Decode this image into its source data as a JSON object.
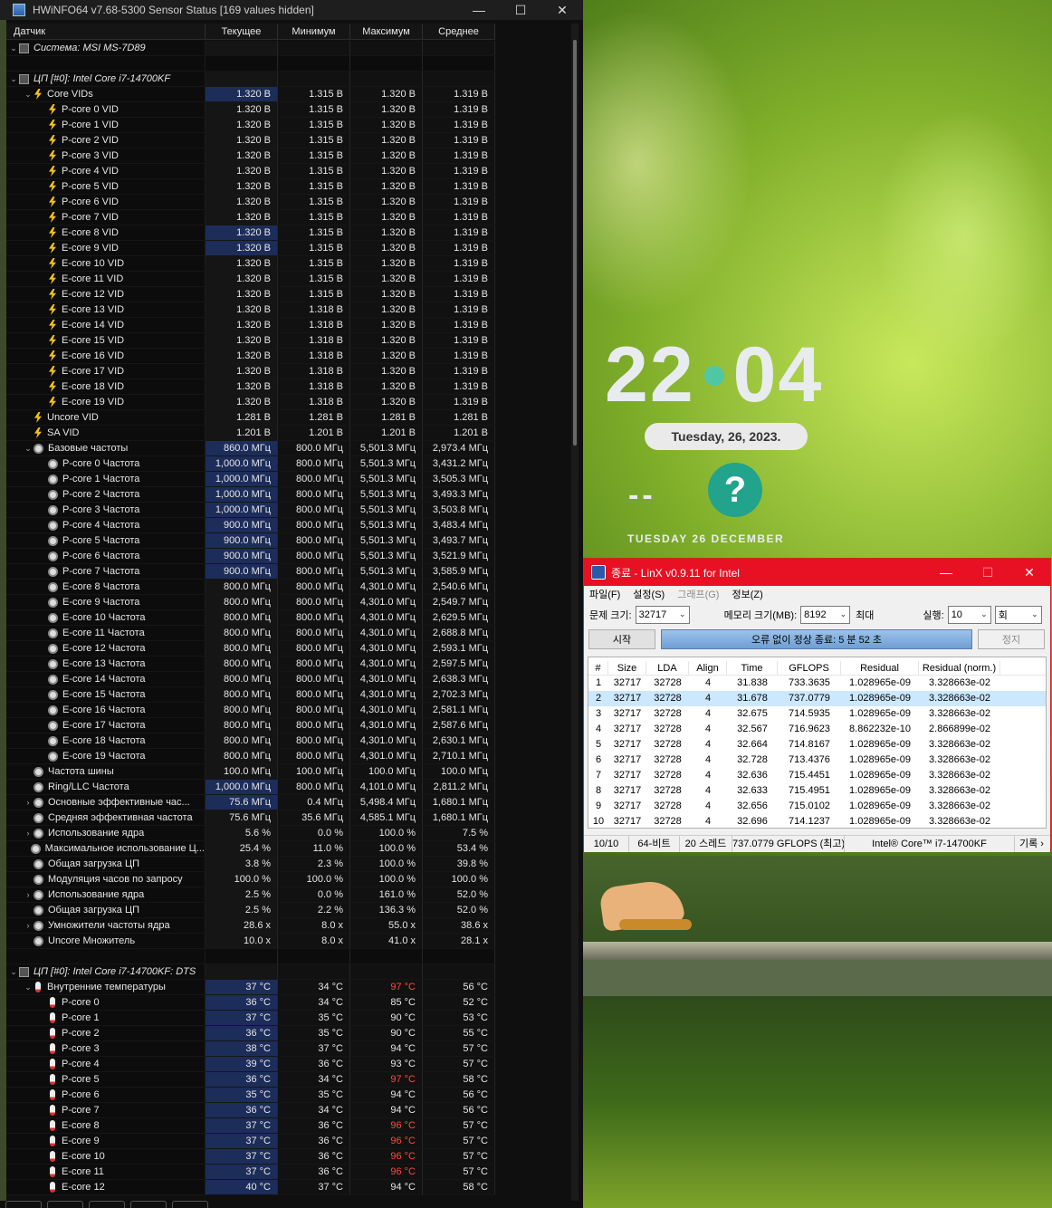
{
  "hwinfo": {
    "title": "HWiNFO64 v7.68-5300 Sensor Status [169 values hidden]",
    "window_buttons": [
      "—",
      "☐",
      "✕"
    ],
    "columns": [
      "Датчик",
      "Текущее",
      "Минимум",
      "Максимум",
      "Среднее"
    ],
    "rows": [
      {
        "t": "grp",
        "lvl": 0,
        "chev": "⌄",
        "icon": "chip",
        "label": "Система: MSI MS-7D89"
      },
      {
        "t": "sep"
      },
      {
        "t": "grp",
        "lvl": 0,
        "chev": "⌄",
        "icon": "chip",
        "label": "ЦП [#0]: Intel Core i7-14700KF"
      },
      {
        "lvl": 1,
        "chev": "⌄",
        "icon": "volt",
        "label": "Core VIDs",
        "v": [
          "1.320 В",
          "1.315 В",
          "1.320 В",
          "1.319 В"
        ],
        "hl": true
      },
      {
        "lvl": 2,
        "icon": "volt",
        "label": "P-core 0 VID",
        "v": [
          "1.320 В",
          "1.315 В",
          "1.320 В",
          "1.319 В"
        ]
      },
      {
        "lvl": 2,
        "icon": "volt",
        "label": "P-core 1 VID",
        "v": [
          "1.320 В",
          "1.315 В",
          "1.320 В",
          "1.319 В"
        ]
      },
      {
        "lvl": 2,
        "icon": "volt",
        "label": "P-core 2 VID",
        "v": [
          "1.320 В",
          "1.315 В",
          "1.320 В",
          "1.319 В"
        ]
      },
      {
        "lvl": 2,
        "icon": "volt",
        "label": "P-core 3 VID",
        "v": [
          "1.320 В",
          "1.315 В",
          "1.320 В",
          "1.319 В"
        ]
      },
      {
        "lvl": 2,
        "icon": "volt",
        "label": "P-core 4 VID",
        "v": [
          "1.320 В",
          "1.315 В",
          "1.320 В",
          "1.319 В"
        ]
      },
      {
        "lvl": 2,
        "icon": "volt",
        "label": "P-core 5 VID",
        "v": [
          "1.320 В",
          "1.315 В",
          "1.320 В",
          "1.319 В"
        ]
      },
      {
        "lvl": 2,
        "icon": "volt",
        "label": "P-core 6 VID",
        "v": [
          "1.320 В",
          "1.315 В",
          "1.320 В",
          "1.319 В"
        ]
      },
      {
        "lvl": 2,
        "icon": "volt",
        "label": "P-core 7 VID",
        "v": [
          "1.320 В",
          "1.315 В",
          "1.320 В",
          "1.319 В"
        ]
      },
      {
        "lvl": 2,
        "icon": "volt",
        "label": "E-core 8 VID",
        "v": [
          "1.320 В",
          "1.315 В",
          "1.320 В",
          "1.319 В"
        ],
        "hl": true
      },
      {
        "lvl": 2,
        "icon": "volt",
        "label": "E-core 9 VID",
        "v": [
          "1.320 В",
          "1.315 В",
          "1.320 В",
          "1.319 В"
        ],
        "hl": true
      },
      {
        "lvl": 2,
        "icon": "volt",
        "label": "E-core 10 VID",
        "v": [
          "1.320 В",
          "1.315 В",
          "1.320 В",
          "1.319 В"
        ]
      },
      {
        "lvl": 2,
        "icon": "volt",
        "label": "E-core 11 VID",
        "v": [
          "1.320 В",
          "1.315 В",
          "1.320 В",
          "1.319 В"
        ]
      },
      {
        "lvl": 2,
        "icon": "volt",
        "label": "E-core 12 VID",
        "v": [
          "1.320 В",
          "1.315 В",
          "1.320 В",
          "1.319 В"
        ]
      },
      {
        "lvl": 2,
        "icon": "volt",
        "label": "E-core 13 VID",
        "v": [
          "1.320 В",
          "1.318 В",
          "1.320 В",
          "1.319 В"
        ]
      },
      {
        "lvl": 2,
        "icon": "volt",
        "label": "E-core 14 VID",
        "v": [
          "1.320 В",
          "1.318 В",
          "1.320 В",
          "1.319 В"
        ]
      },
      {
        "lvl": 2,
        "icon": "volt",
        "label": "E-core 15 VID",
        "v": [
          "1.320 В",
          "1.318 В",
          "1.320 В",
          "1.319 В"
        ]
      },
      {
        "lvl": 2,
        "icon": "volt",
        "label": "E-core 16 VID",
        "v": [
          "1.320 В",
          "1.318 В",
          "1.320 В",
          "1.319 В"
        ]
      },
      {
        "lvl": 2,
        "icon": "volt",
        "label": "E-core 17 VID",
        "v": [
          "1.320 В",
          "1.318 В",
          "1.320 В",
          "1.319 В"
        ]
      },
      {
        "lvl": 2,
        "icon": "volt",
        "label": "E-core 18 VID",
        "v": [
          "1.320 В",
          "1.318 В",
          "1.320 В",
          "1.319 В"
        ]
      },
      {
        "lvl": 2,
        "icon": "volt",
        "label": "E-core 19 VID",
        "v": [
          "1.320 В",
          "1.318 В",
          "1.320 В",
          "1.319 В"
        ]
      },
      {
        "lvl": 1,
        "icon": "volt",
        "label": "Uncore VID",
        "v": [
          "1.281 В",
          "1.281 В",
          "1.281 В",
          "1.281 В"
        ]
      },
      {
        "lvl": 1,
        "icon": "volt",
        "label": "SA VID",
        "v": [
          "1.201 В",
          "1.201 В",
          "1.201 В",
          "1.201 В"
        ]
      },
      {
        "lvl": 1,
        "chev": "⌄",
        "icon": "clock",
        "label": "Базовые частоты",
        "v": [
          "860.0 МГц",
          "800.0 МГц",
          "5,501.3 МГц",
          "2,973.4 МГц"
        ],
        "hl": true
      },
      {
        "lvl": 2,
        "icon": "clock",
        "label": "P-core 0 Частота",
        "v": [
          "1,000.0 МГц",
          "800.0 МГц",
          "5,501.3 МГц",
          "3,431.2 МГц"
        ],
        "hl": true
      },
      {
        "lvl": 2,
        "icon": "clock",
        "label": "P-core 1 Частота",
        "v": [
          "1,000.0 МГц",
          "800.0 МГц",
          "5,501.3 МГц",
          "3,505.3 МГц"
        ],
        "hl": true
      },
      {
        "lvl": 2,
        "icon": "clock",
        "label": "P-core 2 Частота",
        "v": [
          "1,000.0 МГц",
          "800.0 МГц",
          "5,501.3 МГц",
          "3,493.3 МГц"
        ],
        "hl": true
      },
      {
        "lvl": 2,
        "icon": "clock",
        "label": "P-core 3 Частота",
        "v": [
          "1,000.0 МГц",
          "800.0 МГц",
          "5,501.3 МГц",
          "3,503.8 МГц"
        ],
        "hl": true
      },
      {
        "lvl": 2,
        "icon": "clock",
        "label": "P-core 4 Частота",
        "v": [
          "900.0 МГц",
          "800.0 МГц",
          "5,501.3 МГц",
          "3,483.4 МГц"
        ],
        "hl": true
      },
      {
        "lvl": 2,
        "icon": "clock",
        "label": "P-core 5 Частота",
        "v": [
          "900.0 МГц",
          "800.0 МГц",
          "5,501.3 МГц",
          "3,493.7 МГц"
        ],
        "hl": true
      },
      {
        "lvl": 2,
        "icon": "clock",
        "label": "P-core 6 Частота",
        "v": [
          "900.0 МГц",
          "800.0 МГц",
          "5,501.3 МГц",
          "3,521.9 МГц"
        ],
        "hl": true
      },
      {
        "lvl": 2,
        "icon": "clock",
        "label": "P-core 7 Частота",
        "v": [
          "900.0 МГц",
          "800.0 МГц",
          "5,501.3 МГц",
          "3,585.9 МГц"
        ],
        "hl": true
      },
      {
        "lvl": 2,
        "icon": "clock",
        "label": "E-core 8 Частота",
        "v": [
          "800.0 МГц",
          "800.0 МГц",
          "4,301.0 МГц",
          "2,540.6 МГц"
        ]
      },
      {
        "lvl": 2,
        "icon": "clock",
        "label": "E-core 9 Частота",
        "v": [
          "800.0 МГц",
          "800.0 МГц",
          "4,301.0 МГц",
          "2,549.7 МГц"
        ]
      },
      {
        "lvl": 2,
        "icon": "clock",
        "label": "E-core 10 Частота",
        "v": [
          "800.0 МГц",
          "800.0 МГц",
          "4,301.0 МГц",
          "2,629.5 МГц"
        ]
      },
      {
        "lvl": 2,
        "icon": "clock",
        "label": "E-core 11 Частота",
        "v": [
          "800.0 МГц",
          "800.0 МГц",
          "4,301.0 МГц",
          "2,688.8 МГц"
        ]
      },
      {
        "lvl": 2,
        "icon": "clock",
        "label": "E-core 12 Частота",
        "v": [
          "800.0 МГц",
          "800.0 МГц",
          "4,301.0 МГц",
          "2,593.1 МГц"
        ]
      },
      {
        "lvl": 2,
        "icon": "clock",
        "label": "E-core 13 Частота",
        "v": [
          "800.0 МГц",
          "800.0 МГц",
          "4,301.0 МГц",
          "2,597.5 МГц"
        ]
      },
      {
        "lvl": 2,
        "icon": "clock",
        "label": "E-core 14 Частота",
        "v": [
          "800.0 МГц",
          "800.0 МГц",
          "4,301.0 МГц",
          "2,638.3 МГц"
        ]
      },
      {
        "lvl": 2,
        "icon": "clock",
        "label": "E-core 15 Частота",
        "v": [
          "800.0 МГц",
          "800.0 МГц",
          "4,301.0 МГц",
          "2,702.3 МГц"
        ]
      },
      {
        "lvl": 2,
        "icon": "clock",
        "label": "E-core 16 Частота",
        "v": [
          "800.0 МГц",
          "800.0 МГц",
          "4,301.0 МГц",
          "2,581.1 МГц"
        ]
      },
      {
        "lvl": 2,
        "icon": "clock",
        "label": "E-core 17 Частота",
        "v": [
          "800.0 МГц",
          "800.0 МГц",
          "4,301.0 МГц",
          "2,587.6 МГц"
        ]
      },
      {
        "lvl": 2,
        "icon": "clock",
        "label": "E-core 18 Частота",
        "v": [
          "800.0 МГц",
          "800.0 МГц",
          "4,301.0 МГц",
          "2,630.1 МГц"
        ]
      },
      {
        "lvl": 2,
        "icon": "clock",
        "label": "E-core 19 Частота",
        "v": [
          "800.0 МГц",
          "800.0 МГц",
          "4,301.0 МГц",
          "2,710.1 МГц"
        ]
      },
      {
        "lvl": 1,
        "icon": "clock",
        "label": "Частота шины",
        "v": [
          "100.0 МГц",
          "100.0 МГц",
          "100.0 МГц",
          "100.0 МГц"
        ]
      },
      {
        "lvl": 1,
        "icon": "clock",
        "label": "Ring/LLC Частота",
        "v": [
          "1,000.0 МГц",
          "800.0 МГц",
          "4,101.0 МГц",
          "2,811.2 МГц"
        ],
        "hl": true
      },
      {
        "lvl": 1,
        "chev": "›",
        "icon": "clock",
        "label": "Основные эффективные час...",
        "v": [
          "75.6 МГц",
          "0.4 МГц",
          "5,498.4 МГц",
          "1,680.1 МГц"
        ],
        "hl": true
      },
      {
        "lvl": 1,
        "icon": "clock",
        "label": "Средняя эффективная частота",
        "v": [
          "75.6 МГц",
          "35.6 МГц",
          "4,585.1 МГц",
          "1,680.1 МГц"
        ]
      },
      {
        "lvl": 1,
        "chev": "›",
        "icon": "clock",
        "label": "Использование ядра",
        "v": [
          "5.6 %",
          "0.0 %",
          "100.0 %",
          "7.5 %"
        ]
      },
      {
        "lvl": 1,
        "icon": "clock",
        "label": "Максимальное использование Ц...",
        "v": [
          "25.4 %",
          "11.0 %",
          "100.0 %",
          "53.4 %"
        ]
      },
      {
        "lvl": 1,
        "icon": "clock",
        "label": "Общая загрузка ЦП",
        "v": [
          "3.8 %",
          "2.3 %",
          "100.0 %",
          "39.8 %"
        ]
      },
      {
        "lvl": 1,
        "icon": "clock",
        "label": "Модуляция часов по запросу",
        "v": [
          "100.0 %",
          "100.0 %",
          "100.0 %",
          "100.0 %"
        ]
      },
      {
        "lvl": 1,
        "chev": "›",
        "icon": "clock",
        "label": "Использование ядра",
        "v": [
          "2.5 %",
          "0.0 %",
          "161.0 %",
          "52.0 %"
        ]
      },
      {
        "lvl": 1,
        "icon": "clock",
        "label": "Общая загрузка ЦП",
        "v": [
          "2.5 %",
          "2.2 %",
          "136.3 %",
          "52.0 %"
        ]
      },
      {
        "lvl": 1,
        "chev": "›",
        "icon": "clock",
        "label": "Умножители частоты ядра",
        "v": [
          "28.6 x",
          "8.0 x",
          "55.0 x",
          "38.6 x"
        ]
      },
      {
        "lvl": 1,
        "icon": "clock",
        "label": "Uncore Множитель",
        "v": [
          "10.0 x",
          "8.0 x",
          "41.0 x",
          "28.1 x"
        ]
      },
      {
        "t": "sep"
      },
      {
        "t": "grp",
        "lvl": 0,
        "chev": "⌄",
        "icon": "chip",
        "label": "ЦП [#0]: Intel Core i7-14700KF: DTS"
      },
      {
        "lvl": 1,
        "chev": "⌄",
        "icon": "temp",
        "label": "Внутренние температуры",
        "v": [
          "37 °C",
          "34 °C",
          "97 °C",
          "56 °C"
        ],
        "hl": true,
        "redmax": true
      },
      {
        "lvl": 2,
        "icon": "temp",
        "label": "P-core 0",
        "v": [
          "36 °C",
          "34 °C",
          "85 °C",
          "52 °C"
        ],
        "hl": true
      },
      {
        "lvl": 2,
        "icon": "temp",
        "label": "P-core 1",
        "v": [
          "37 °C",
          "35 °C",
          "90 °C",
          "53 °C"
        ],
        "hl": true
      },
      {
        "lvl": 2,
        "icon": "temp",
        "label": "P-core 2",
        "v": [
          "36 °C",
          "35 °C",
          "90 °C",
          "55 °C"
        ],
        "hl": true
      },
      {
        "lvl": 2,
        "icon": "temp",
        "label": "P-core 3",
        "v": [
          "38 °C",
          "37 °C",
          "94 °C",
          "57 °C"
        ],
        "hl": true
      },
      {
        "lvl": 2,
        "icon": "temp",
        "label": "P-core 4",
        "v": [
          "39 °C",
          "36 °C",
          "93 °C",
          "57 °C"
        ],
        "hl": true
      },
      {
        "lvl": 2,
        "icon": "temp",
        "label": "P-core 5",
        "v": [
          "36 °C",
          "34 °C",
          "97 °C",
          "58 °C"
        ],
        "hl": true,
        "redmax": true
      },
      {
        "lvl": 2,
        "icon": "temp",
        "label": "P-core 6",
        "v": [
          "35 °C",
          "35 °C",
          "94 °C",
          "56 °C"
        ],
        "hl": true
      },
      {
        "lvl": 2,
        "icon": "temp",
        "label": "P-core 7",
        "v": [
          "36 °C",
          "34 °C",
          "94 °C",
          "56 °C"
        ],
        "hl": true
      },
      {
        "lvl": 2,
        "icon": "temp",
        "label": "E-core 8",
        "v": [
          "37 °C",
          "36 °C",
          "96 °C",
          "57 °C"
        ],
        "hl": true,
        "redmax": true
      },
      {
        "lvl": 2,
        "icon": "temp",
        "label": "E-core 9",
        "v": [
          "37 °C",
          "36 °C",
          "96 °C",
          "57 °C"
        ],
        "hl": true,
        "redmax": true
      },
      {
        "lvl": 2,
        "icon": "temp",
        "label": "E-core 10",
        "v": [
          "37 °C",
          "36 °C",
          "96 °C",
          "57 °C"
        ],
        "hl": true,
        "redmax": true
      },
      {
        "lvl": 2,
        "icon": "temp",
        "label": "E-core 11",
        "v": [
          "37 °C",
          "36 °C",
          "96 °C",
          "57 °C"
        ],
        "hl": true,
        "redmax": true
      },
      {
        "lvl": 2,
        "icon": "temp",
        "label": "E-core 12",
        "v": [
          "40 °C",
          "37 °C",
          "94 °C",
          "58 °C"
        ],
        "hl": true
      }
    ]
  },
  "lockscreen": {
    "hour": "22",
    "minute": "04",
    "date_pill": "Tuesday, 26, 2023.",
    "dashes": "--",
    "weather_icon": "?",
    "day_line": "TUESDAY 26 DECEMBER"
  },
  "linx": {
    "title": "종료 - LinX v0.9.11 for Intel",
    "window_buttons": [
      "—",
      "☐",
      "✕"
    ],
    "menu": [
      "파일(F)",
      "설정(S)",
      "그래프(G)",
      "정보(Z)"
    ],
    "problem_size_label": "문제 크기:",
    "problem_size": "32717",
    "memory_label": "메모리 크기(MB):",
    "memory": "8192",
    "max_label": "최대",
    "runs_label": "실행:",
    "runs": "10",
    "runs_unit": "회",
    "start_button": "시작",
    "status": "오류 없이 정상 종료: 5 분 52 초",
    "stop_button": "정지",
    "columns": [
      "#",
      "Size",
      "LDA",
      "Align",
      "Time",
      "GFLOPS",
      "Residual",
      "Residual (norm.)"
    ],
    "rows": [
      [
        "1",
        "32717",
        "32728",
        "4",
        "31.838",
        "733.3635",
        "1.028965e-09",
        "3.328663e-02"
      ],
      [
        "2",
        "32717",
        "32728",
        "4",
        "31.678",
        "737.0779",
        "1.028965e-09",
        "3.328663e-02"
      ],
      [
        "3",
        "32717",
        "32728",
        "4",
        "32.675",
        "714.5935",
        "1.028965e-09",
        "3.328663e-02"
      ],
      [
        "4",
        "32717",
        "32728",
        "4",
        "32.567",
        "716.9623",
        "8.862232e-10",
        "2.866899e-02"
      ],
      [
        "5",
        "32717",
        "32728",
        "4",
        "32.664",
        "714.8167",
        "1.028965e-09",
        "3.328663e-02"
      ],
      [
        "6",
        "32717",
        "32728",
        "4",
        "32.728",
        "713.4376",
        "1.028965e-09",
        "3.328663e-02"
      ],
      [
        "7",
        "32717",
        "32728",
        "4",
        "32.636",
        "715.4451",
        "1.028965e-09",
        "3.328663e-02"
      ],
      [
        "8",
        "32717",
        "32728",
        "4",
        "32.633",
        "715.4951",
        "1.028965e-09",
        "3.328663e-02"
      ],
      [
        "9",
        "32717",
        "32728",
        "4",
        "32.656",
        "715.0102",
        "1.028965e-09",
        "3.328663e-02"
      ],
      [
        "10",
        "32717",
        "32728",
        "4",
        "32.696",
        "714.1237",
        "1.028965e-09",
        "3.328663e-02"
      ]
    ],
    "selected_row": "2",
    "footer": [
      "10/10",
      "64-비트",
      "20 스레드",
      "737.0779 GFLOPS (최고)",
      "Intel® Core™ i7-14700KF",
      "기록 ›"
    ]
  }
}
